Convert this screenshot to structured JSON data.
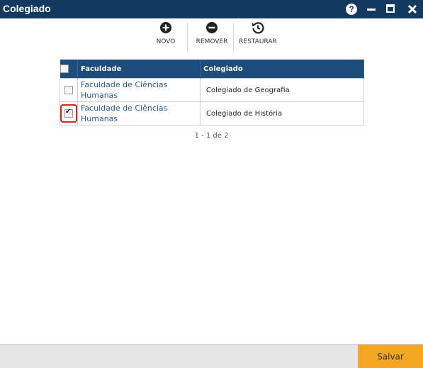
{
  "window": {
    "title": "Colegiado",
    "help_symbol": "?"
  },
  "toolbar": {
    "novo_label": "NOVO",
    "remover_label": "REMOVER",
    "restaurar_label": "RESTAURAR"
  },
  "table": {
    "headers": {
      "faculdade": "Faculdade",
      "colegiado": "Colegiado"
    },
    "rows": [
      {
        "faculdade": "Faculdade de Ciências Humanas",
        "colegiado": "Colegiado de Geografia",
        "checked": false
      },
      {
        "faculdade": "Faculdade de Ciências Humanas",
        "colegiado": "Colegiado de História",
        "checked": true
      }
    ]
  },
  "pager": {
    "text": "1 - 1 de 2"
  },
  "footer": {
    "save_label": "Salvar"
  },
  "colors": {
    "titlebar": "#123a5e",
    "table_header": "#1f4d7b",
    "link": "#2a5b8c",
    "save_button": "#f5a623",
    "highlight": "#e02020"
  }
}
